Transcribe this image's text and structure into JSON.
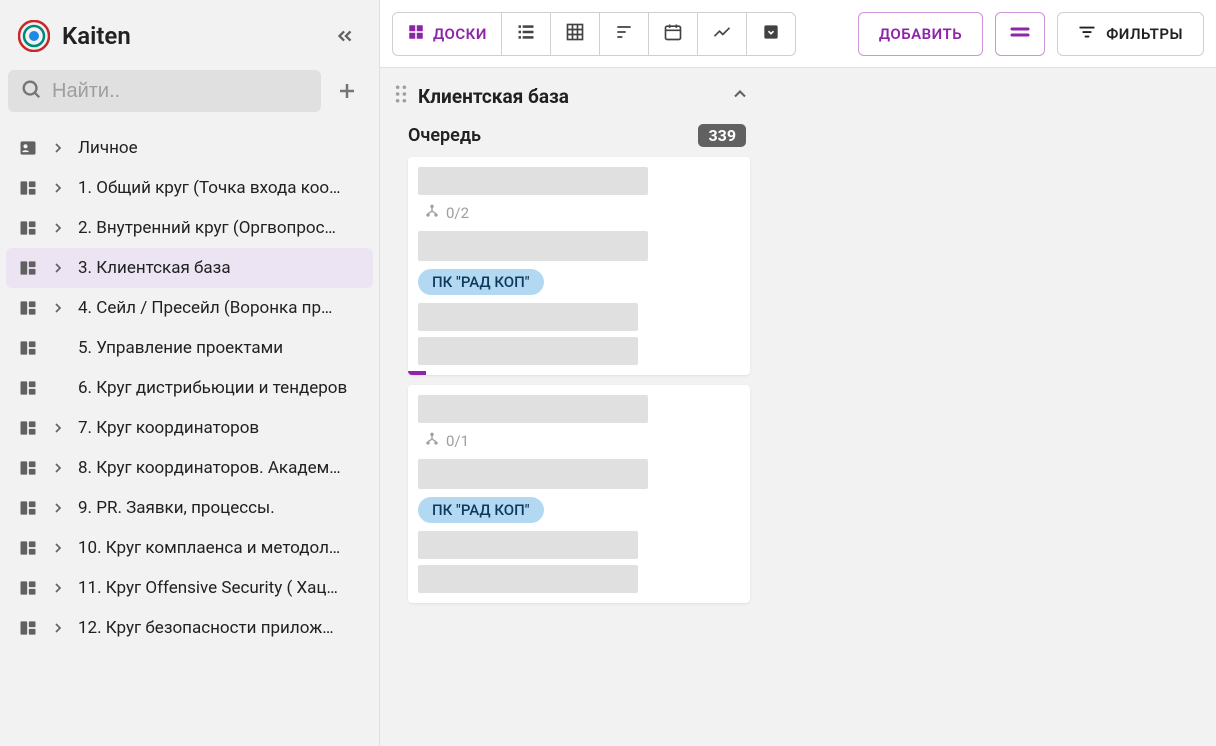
{
  "app": {
    "name": "Kaiten"
  },
  "search": {
    "placeholder": "Найти.."
  },
  "sidebar": {
    "items": [
      {
        "label": "Личное",
        "icon": "person-card",
        "expandable": true,
        "active": false
      },
      {
        "label": "1. Общий круг (Точка входа коо…",
        "icon": "board",
        "expandable": true,
        "active": false
      },
      {
        "label": "2. Внутренний круг (Оргвопрос…",
        "icon": "board",
        "expandable": true,
        "active": false
      },
      {
        "label": "3. Клиентская база",
        "icon": "board",
        "expandable": true,
        "active": true
      },
      {
        "label": "4. Сейл / Пресейл (Воронка пр…",
        "icon": "board",
        "expandable": true,
        "active": false
      },
      {
        "label": "5. Управление проектами",
        "icon": "board",
        "expandable": false,
        "active": false
      },
      {
        "label": "6. Круг дистрибьюции и тендеров",
        "icon": "board",
        "expandable": false,
        "active": false
      },
      {
        "label": "7. Круг координаторов",
        "icon": "board",
        "expandable": true,
        "active": false
      },
      {
        "label": "8. Круг координаторов. Академ…",
        "icon": "board",
        "expandable": true,
        "active": false
      },
      {
        "label": "9. PR. Заявки, процессы.",
        "icon": "board",
        "expandable": true,
        "active": false
      },
      {
        "label": "10. Круг комплаенса и методол…",
        "icon": "board",
        "expandable": true,
        "active": false
      },
      {
        "label": "11. Круг Offensive Security ( Хац…",
        "icon": "board",
        "expandable": true,
        "active": false
      },
      {
        "label": "12. Круг безопасности прилож…",
        "icon": "board",
        "expandable": true,
        "active": false
      }
    ]
  },
  "toolbar": {
    "views": {
      "boards": "ДОСКИ"
    },
    "add_label": "ДОБАВИТЬ",
    "filters_label": "ФИЛЬТРЫ"
  },
  "board": {
    "panel_title": "Клиентская база",
    "column_title": "Очередь",
    "column_count": "339",
    "cards": [
      {
        "subtasks": "0/2",
        "tag": "ПК \"РАД КОП\""
      },
      {
        "subtasks": "0/1",
        "tag": "ПК \"РАД КОП\""
      }
    ]
  }
}
